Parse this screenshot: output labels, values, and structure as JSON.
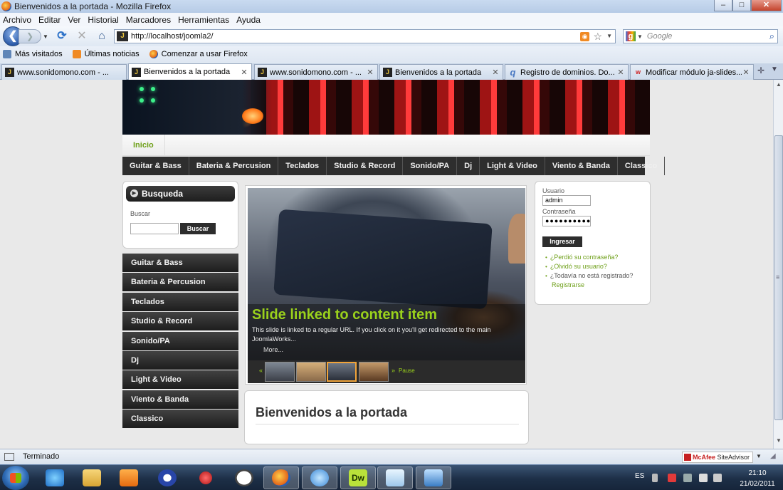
{
  "window": {
    "title": "Bienvenidos a la portada - Mozilla Firefox"
  },
  "menu": [
    "Archivo",
    "Editar",
    "Ver",
    "Historial",
    "Marcadores",
    "Herramientas",
    "Ayuda"
  ],
  "navbar": {
    "url": "http://localhost/joomla2/",
    "search_placeholder": "Google"
  },
  "bookmarks": [
    "Más visitados",
    "Últimas noticias",
    "Comenzar a usar Firefox"
  ],
  "tabs": [
    {
      "label": "www.sonidomono.com - ...",
      "favicon": "joomla-icon",
      "active": false
    },
    {
      "label": "Bienvenidos a la portada",
      "favicon": "joomla-icon",
      "active": true
    },
    {
      "label": "www.sonidomono.com - ...",
      "favicon": "joomla-icon",
      "active": false
    },
    {
      "label": "Bienvenidos a la portada",
      "favicon": "joomla-icon",
      "active": false
    },
    {
      "label": "Registro de dominios. Do...",
      "favicon": "q-icon",
      "active": false
    },
    {
      "label": "Modificar módulo ja-slides...",
      "favicon": "w-icon",
      "active": false
    }
  ],
  "page": {
    "topnav": {
      "inicio": "Inicio"
    },
    "categories": [
      "Guitar & Bass",
      "Bateria & Percusion",
      "Teclados",
      "Studio & Record",
      "Sonido/PA",
      "Dj",
      "Light & Video",
      "Viento & Banda",
      "Classico"
    ],
    "search": {
      "heading": "Busqueda",
      "label": "Buscar",
      "button": "Buscar"
    },
    "left_menu": [
      "Guitar & Bass",
      "Bateria & Percusion",
      "Teclados",
      "Studio & Record",
      "Sonido/PA",
      "Dj",
      "Light & Video",
      "Viento & Banda",
      "Classico"
    ],
    "slideshow": {
      "title": "Slide linked to content item",
      "description": "This slide is linked to a regular URL. If you click on it you'll get redirected to the main JoomlaWorks...",
      "more": "More...",
      "prev": "«",
      "next": "»",
      "pause": "Pause"
    },
    "welcome": {
      "heading": "Bienvenidos a la portada"
    },
    "login": {
      "user_label": "Usuario",
      "user_value": "admin",
      "pass_label": "Contraseña",
      "pass_value": "●●●●●●●●●●",
      "button": "Ingresar",
      "forgot_password": "¿Perdió su contraseña?",
      "forgot_user": "¿Olvidó su usuario?",
      "not_registered": "¿Todavía no está registrado?",
      "register": "Registrarse"
    }
  },
  "status": {
    "text": "Terminado",
    "siteadvisor": "McAfee SiteAdvisor",
    "siteadvisor_brand": "McAfee",
    "siteadvisor_name": "SiteAdvisor"
  },
  "taskbar": {
    "lang": "ES",
    "time": "21:10",
    "date": "21/02/2011",
    "apps": [
      "start-orb",
      "ie-icon",
      "explorer-icon",
      "media-player-icon",
      "user-icon",
      "pin-icon",
      "clock-icon",
      "firefox-icon",
      "network-icon",
      "dreamweaver-icon",
      "notepad-icon",
      "screenshot-icon"
    ],
    "dw_label": "Dw"
  },
  "colors": {
    "accent_green": "#9ad11c",
    "link_green": "#6fa01a",
    "menu_dark": "#2e2e2e"
  }
}
